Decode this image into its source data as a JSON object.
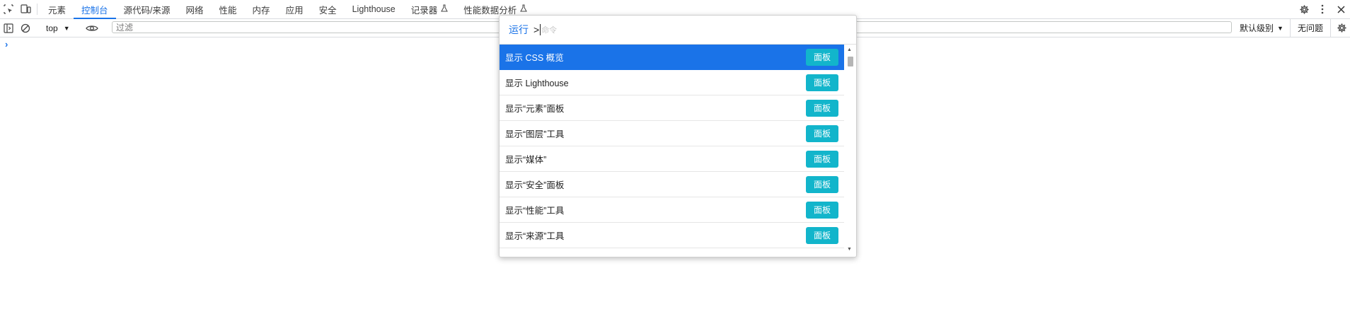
{
  "tabs": [
    {
      "label": "元素",
      "active": false,
      "experimental": false
    },
    {
      "label": "控制台",
      "active": true,
      "experimental": false
    },
    {
      "label": "源代码/来源",
      "active": false,
      "experimental": false
    },
    {
      "label": "网络",
      "active": false,
      "experimental": false
    },
    {
      "label": "性能",
      "active": false,
      "experimental": false
    },
    {
      "label": "内存",
      "active": false,
      "experimental": false
    },
    {
      "label": "应用",
      "active": false,
      "experimental": false
    },
    {
      "label": "安全",
      "active": false,
      "experimental": false
    },
    {
      "label": "Lighthouse",
      "active": false,
      "experimental": false
    },
    {
      "label": "记录器",
      "active": false,
      "experimental": true
    },
    {
      "label": "性能数据分析",
      "active": false,
      "experimental": true
    }
  ],
  "icons": {
    "inspect": "inspect-element-icon",
    "device": "device-toolbar-icon",
    "settings": "gear-icon",
    "more": "kebab-menu-icon",
    "close": "close-icon",
    "sidebar": "sidebar-toggle-icon",
    "clear": "clear-console-icon",
    "eye": "eye-icon",
    "flask": "flask-icon"
  },
  "toolbar": {
    "context": "top",
    "filter_placeholder": "过滤",
    "level": "默认级别",
    "issues": "无问题"
  },
  "command_menu": {
    "prefix": "运行",
    "input_value": ">",
    "placeholder": "命令",
    "items": [
      {
        "label": "显示 CSS 概览",
        "badge": "面板",
        "selected": true
      },
      {
        "label": "显示 Lighthouse",
        "badge": "面板",
        "selected": false
      },
      {
        "label": "显示“元素”面板",
        "badge": "面板",
        "selected": false
      },
      {
        "label": "显示“图层”工具",
        "badge": "面板",
        "selected": false
      },
      {
        "label": "显示“媒体”",
        "badge": "面板",
        "selected": false
      },
      {
        "label": "显示“安全”面板",
        "badge": "面板",
        "selected": false
      },
      {
        "label": "显示“性能”工具",
        "badge": "面板",
        "selected": false
      },
      {
        "label": "显示“来源”工具",
        "badge": "面板",
        "selected": false
      }
    ]
  },
  "colors": {
    "accent": "#1a73e8",
    "badge": "#12b5cb"
  }
}
